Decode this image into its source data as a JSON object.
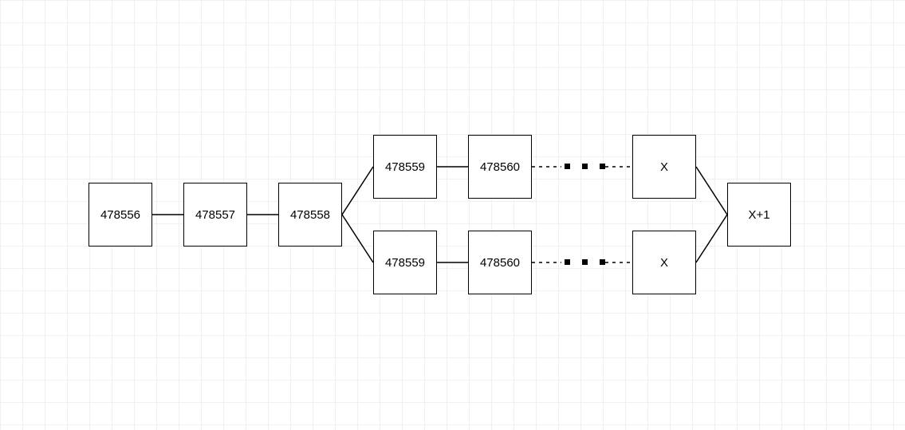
{
  "diagram": {
    "nodes": {
      "chain": [
        "478556",
        "478557",
        "478558"
      ],
      "branch_top": [
        "478559",
        "478560",
        "X"
      ],
      "branch_bottom": [
        "478559",
        "478560",
        "X"
      ],
      "merge": "X+1"
    }
  }
}
